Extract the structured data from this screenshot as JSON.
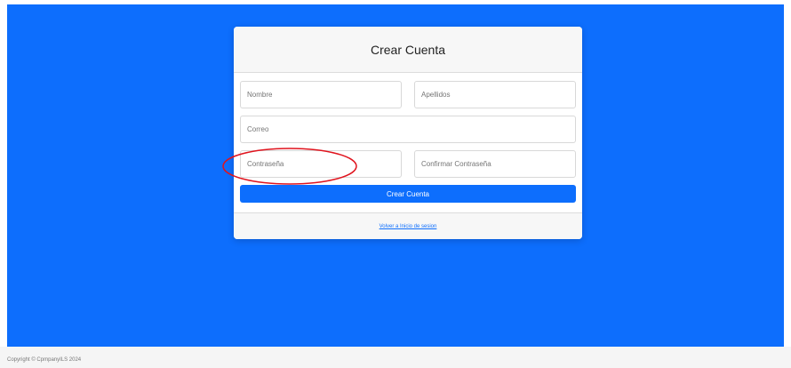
{
  "card": {
    "title": "Crear Cuenta"
  },
  "form": {
    "nombre": {
      "placeholder": "Nombre",
      "value": ""
    },
    "apellidos": {
      "placeholder": "Apellidos",
      "value": ""
    },
    "correo": {
      "placeholder": "Correo",
      "value": ""
    },
    "contrasena": {
      "placeholder": "Contraseña",
      "value": ""
    },
    "confirmar_contrasena": {
      "placeholder": "Confirmar Contraseña",
      "value": ""
    },
    "submit_label": "Crear Cuenta"
  },
  "links": {
    "back_to_login": "Volver a Inicio de sesion"
  },
  "footer": {
    "copyright": "Copyright © CpmpanyILS 2024"
  },
  "colors": {
    "background": "#0d6efd",
    "button": "#0d6efd",
    "annotation": "#e0141e"
  }
}
